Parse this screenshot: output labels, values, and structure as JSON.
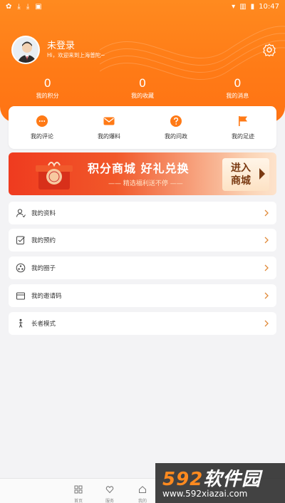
{
  "status_bar": {
    "time": "10:47",
    "icons": [
      "app-icon",
      "download-icon",
      "download-icon",
      "card-icon",
      "wifi-icon",
      "sim-icon",
      "battery-icon"
    ]
  },
  "profile": {
    "name": "未登录",
    "greeting": "Hi，欢迎来到上海普陀~"
  },
  "stats": [
    {
      "value": "0",
      "label": "我的积分"
    },
    {
      "value": "0",
      "label": "我的收藏"
    },
    {
      "value": "0",
      "label": "我的消息"
    }
  ],
  "quick_actions": [
    {
      "label": "我的评论",
      "icon": "comment-icon"
    },
    {
      "label": "我的爆料",
      "icon": "mail-icon"
    },
    {
      "label": "我的问政",
      "icon": "question-icon"
    },
    {
      "label": "我的足迹",
      "icon": "flag-icon"
    }
  ],
  "banner": {
    "title": "积分商城 好礼兑换",
    "subtitle": "—— 精选福利送不停 ——",
    "cta_line1": "进入",
    "cta_line2": "商城"
  },
  "menu": [
    {
      "label": "我的资料",
      "icon": "user-icon"
    },
    {
      "label": "我的预约",
      "icon": "edit-icon"
    },
    {
      "label": "我的圈子",
      "icon": "circle-icon"
    },
    {
      "label": "我的邀请码",
      "icon": "card-icon"
    },
    {
      "label": "长者模式",
      "icon": "elder-icon"
    }
  ],
  "bottom_nav": [
    {
      "label": "首页",
      "icon": "grid-icon"
    },
    {
      "label": "服务",
      "icon": "heart-icon"
    },
    {
      "label": "我的",
      "icon": "home-icon"
    }
  ],
  "watermark": {
    "logo_num": "592",
    "logo_text": "软件园",
    "url": "www.592xiazai.com"
  },
  "colors": {
    "accent": "#ff7a16",
    "banner_red": "#ef3b1f"
  }
}
